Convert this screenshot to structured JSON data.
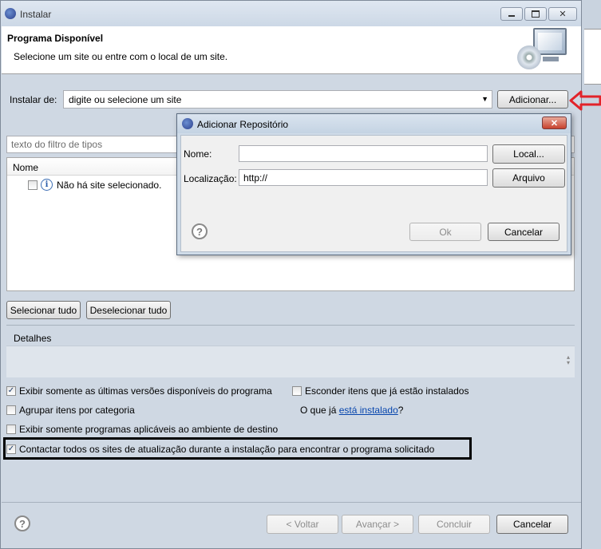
{
  "window": {
    "title": "Instalar"
  },
  "header": {
    "title": "Programa Disponível",
    "subtitle": "Selecione um site ou entre com o local de um site."
  },
  "install_from": {
    "label": "Instalar de:",
    "value": "digite ou selecione um site",
    "add_button": "Adicionar..."
  },
  "filter": {
    "placeholder": "texto do filtro de tipos"
  },
  "table": {
    "column_header": "Nome",
    "empty_row": "Não há site selecionado."
  },
  "selection_buttons": {
    "select_all": "Selecionar tudo",
    "deselect_all": "Deselecionar tudo"
  },
  "details": {
    "label": "Detalhes"
  },
  "options": {
    "show_latest": {
      "label": "Exibir somente as últimas versões disponíveis do programa",
      "checked": true
    },
    "hide_installed": {
      "label": "Esconder itens que já estão instalados",
      "checked": false
    },
    "group_by_category": {
      "label": "Agrupar itens por categoria",
      "checked": false
    },
    "whats_installed_prefix": "O que já",
    "whats_installed_link": "está instalado",
    "whats_installed_suffix": "?",
    "show_applicable": {
      "label": "Exibir somente programas aplicáveis ao ambiente de destino",
      "checked": false
    },
    "contact_all_sites": {
      "label": "Contactar todos os sites de atualização durante a instalação para encontrar o programa solicitado",
      "checked": true
    }
  },
  "footer": {
    "back": "< Voltar",
    "next": "Avançar >",
    "finish": "Concluir",
    "cancel": "Cancelar"
  },
  "dialog": {
    "title": "Adicionar Repositório",
    "name_label": "Nome:",
    "name_value": "",
    "location_label": "Localização:",
    "location_value": "http://",
    "local_button": "Local...",
    "archive_button": "Arquivo",
    "ok_button": "Ok",
    "cancel_button": "Cancelar"
  },
  "icons": {
    "help": "?",
    "info": "i",
    "check": "✓",
    "close": "✕",
    "minimize": "▭",
    "maximize": "□",
    "dropdown": "▼"
  }
}
